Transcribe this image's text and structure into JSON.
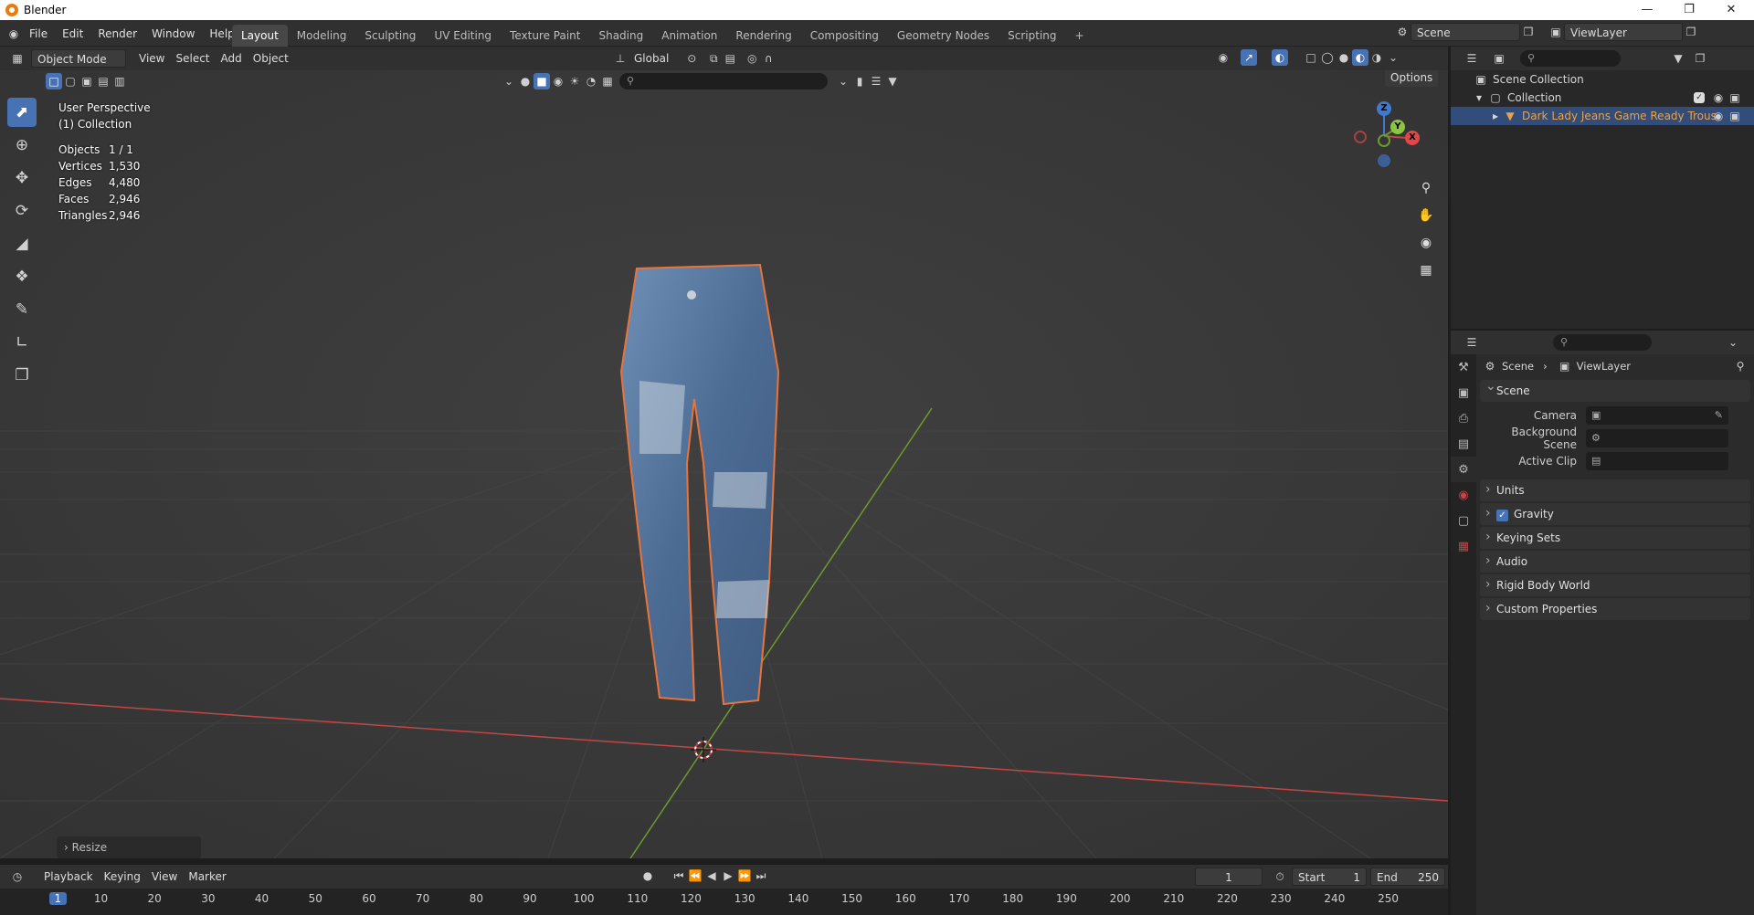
{
  "titlebar": {
    "title": "Blender"
  },
  "menus": [
    "File",
    "Edit",
    "Render",
    "Window",
    "Help"
  ],
  "workspaces": [
    "Layout",
    "Modeling",
    "Sculpting",
    "UV Editing",
    "Texture Paint",
    "Shading",
    "Animation",
    "Rendering",
    "Compositing",
    "Geometry Nodes",
    "Scripting",
    "+"
  ],
  "scene_selector": {
    "label": "Scene",
    "view_layer": "ViewLayer"
  },
  "header3d": {
    "mode": "Object Mode",
    "menu": [
      "View",
      "Select",
      "Add",
      "Object"
    ],
    "transform_orientation": "Global",
    "options": "Options"
  },
  "viewport": {
    "perspective": "User Perspective",
    "collection": "(1) Collection",
    "stats": [
      {
        "label": "Objects",
        "value": "1 / 1"
      },
      {
        "label": "Vertices",
        "value": "1,530"
      },
      {
        "label": "Edges",
        "value": "4,480"
      },
      {
        "label": "Faces",
        "value": "2,946"
      },
      {
        "label": "Triangles",
        "value": "2,946"
      }
    ],
    "gizmo": {
      "z": "Z",
      "y": "Y",
      "x": "X"
    },
    "last_op": "Resize"
  },
  "timeline": {
    "menu": [
      "Playback",
      "Keying",
      "View",
      "Marker"
    ],
    "current_frame": "1",
    "start_label": "Start",
    "start": "1",
    "end_label": "End",
    "end": "250",
    "ticks": [
      "1",
      "10",
      "20",
      "30",
      "40",
      "50",
      "60",
      "70",
      "80",
      "90",
      "100",
      "110",
      "120",
      "130",
      "140",
      "150",
      "160",
      "170",
      "180",
      "190",
      "200",
      "210",
      "220",
      "230",
      "240",
      "250"
    ],
    "playhead": "1"
  },
  "outliner": {
    "root": "Scene Collection",
    "collection": "Collection",
    "object": "Dark Lady Jeans Game Ready Trous",
    "object_color": "#e8a24a"
  },
  "properties": {
    "breadcrumb": [
      "Scene",
      "ViewLayer"
    ],
    "scene_panel": "Scene",
    "fields": [
      {
        "label": "Camera"
      },
      {
        "label": "Background Scene"
      },
      {
        "label": "Active Clip"
      }
    ],
    "panels": [
      "Units",
      "Gravity",
      "Keying Sets",
      "Audio",
      "Rigid Body World",
      "Custom Properties"
    ]
  },
  "colors": {
    "accent": "#4772b3",
    "selection_outline": "#e9743a",
    "x_axis": "#c44545",
    "y_axis": "#6d9a2c"
  }
}
